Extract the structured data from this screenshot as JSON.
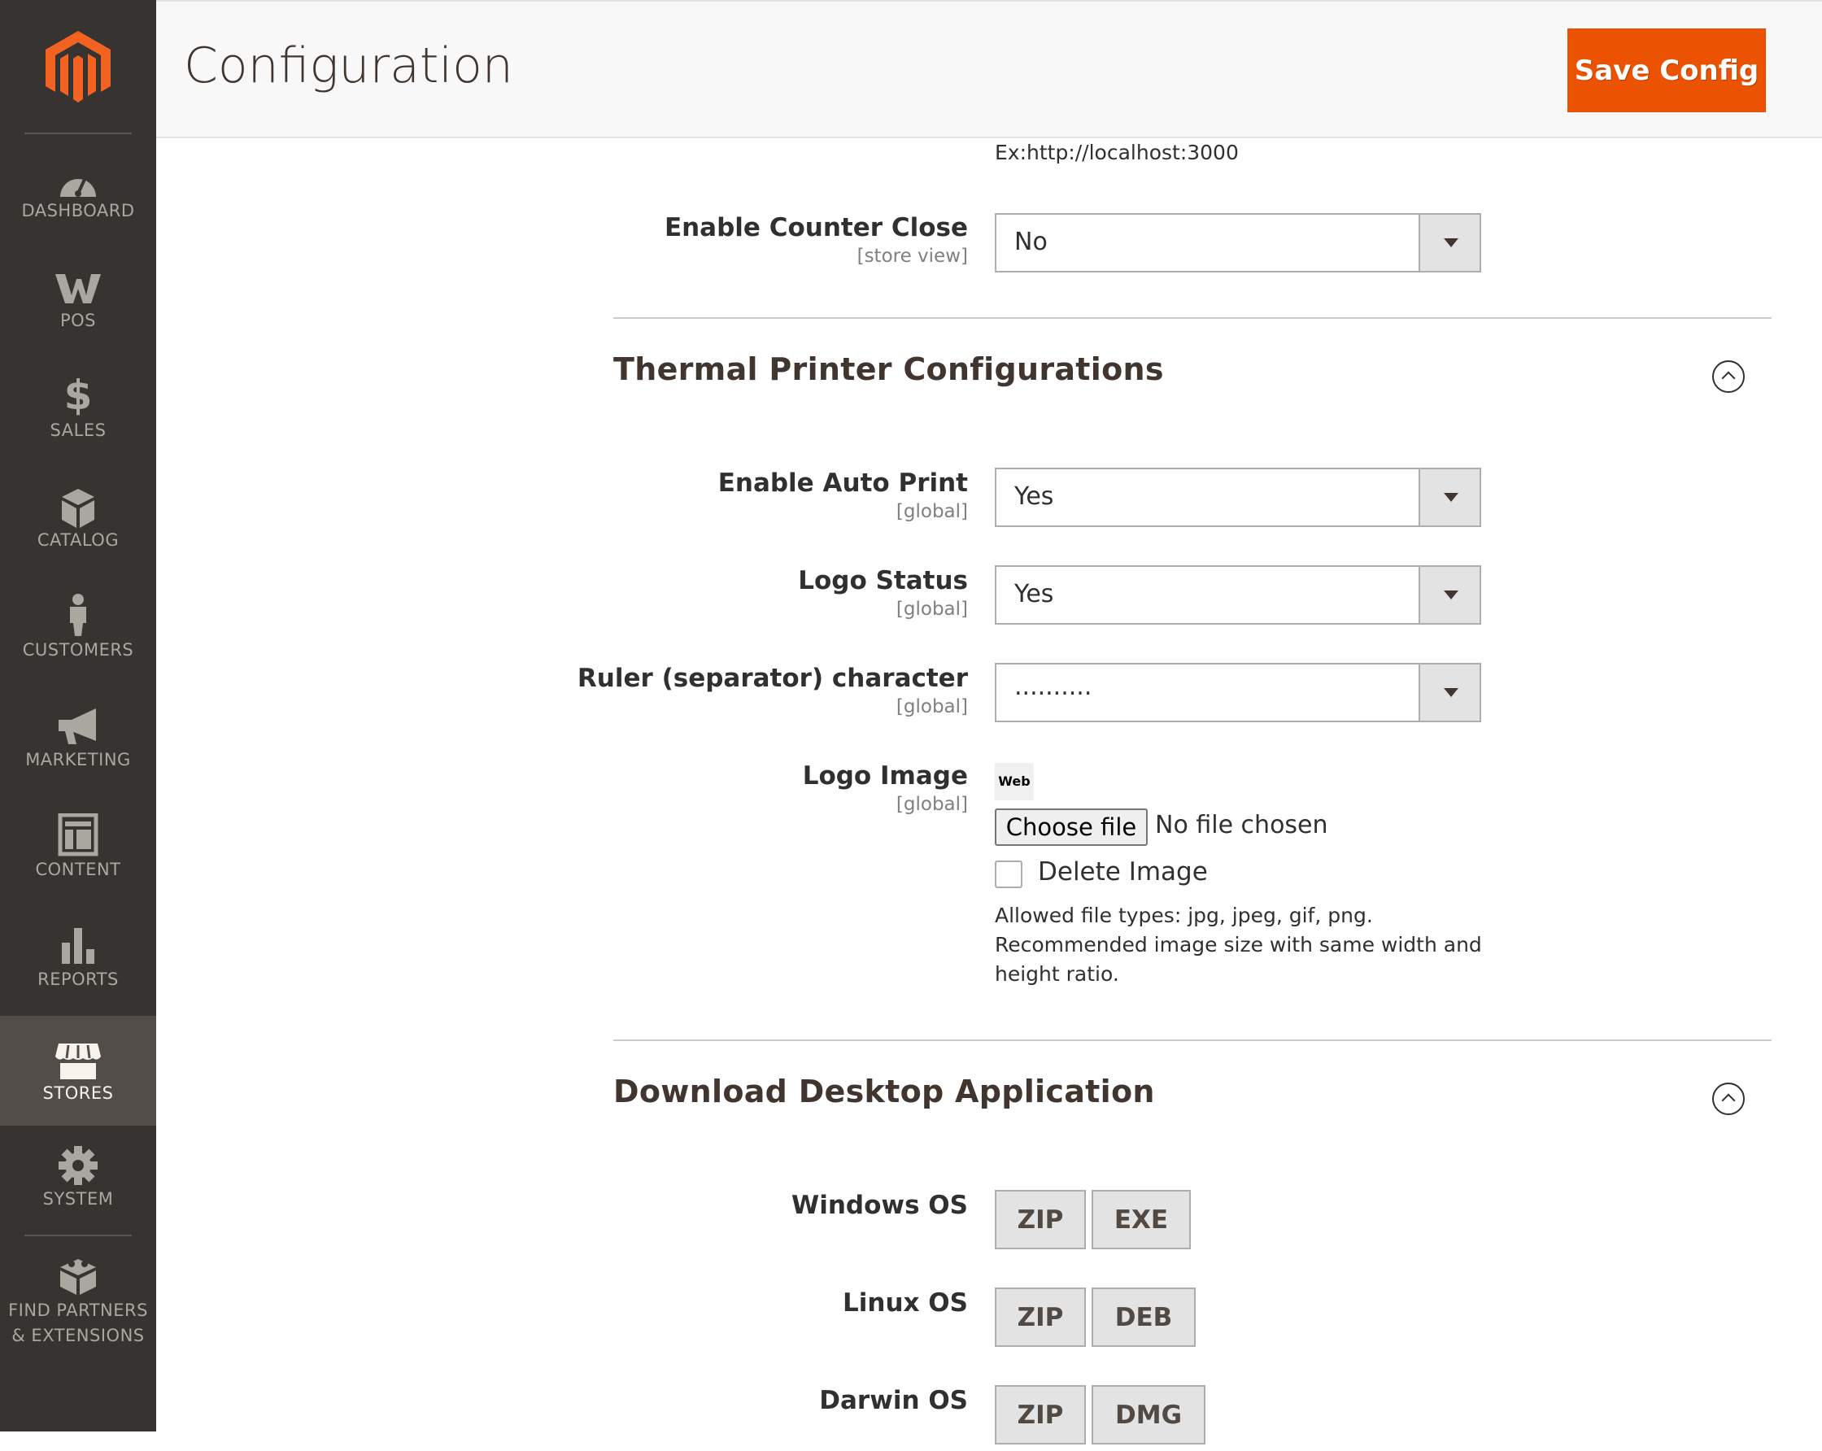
{
  "sidebar": {
    "items": [
      {
        "label": "DASHBOARD",
        "icon": "dashboard-icon"
      },
      {
        "label": "POS",
        "icon": "pos-icon"
      },
      {
        "label": "SALES",
        "icon": "dollar-icon"
      },
      {
        "label": "CATALOG",
        "icon": "cube-icon"
      },
      {
        "label": "CUSTOMERS",
        "icon": "person-icon"
      },
      {
        "label": "MARKETING",
        "icon": "megaphone-icon"
      },
      {
        "label": "CONTENT",
        "icon": "layout-icon"
      },
      {
        "label": "REPORTS",
        "icon": "bar-chart-icon"
      },
      {
        "label": "STORES",
        "icon": "storefront-icon",
        "active": true
      },
      {
        "label": "SYSTEM",
        "icon": "gear-icon"
      },
      {
        "label_line1": "FIND PARTNERS",
        "label_line2": "& EXTENSIONS",
        "icon": "blocks-icon"
      }
    ]
  },
  "header": {
    "title": "Configuration",
    "save_label": "Save Config"
  },
  "socket": {
    "hint": "Ex:http://localhost:3000"
  },
  "counter_close": {
    "label": "Enable Counter Close",
    "scope": "[store view]",
    "value": "No"
  },
  "thermal": {
    "title": "Thermal Printer Configurations",
    "auto_print": {
      "label": "Enable Auto Print",
      "scope": "[global]",
      "value": "Yes"
    },
    "logo_status": {
      "label": "Logo Status",
      "scope": "[global]",
      "value": "Yes"
    },
    "ruler": {
      "label": "Ruler (separator) character",
      "scope": "[global]",
      "value": ".........."
    },
    "logo_image": {
      "label": "Logo Image",
      "scope": "[global]",
      "thumb_text": "Web",
      "choose_file": "Choose file",
      "file_status": "No file chosen",
      "delete_label": "Delete Image",
      "note_line1": "Allowed file types: jpg, jpeg, gif, png.",
      "note_line2": "Recommended image size with same width and",
      "note_line3": "height ratio."
    }
  },
  "download": {
    "title": "Download Desktop Application",
    "windows": {
      "label": "Windows OS",
      "btn1": "ZIP",
      "btn2": "EXE"
    },
    "linux": {
      "label": "Linux OS",
      "btn1": "ZIP",
      "btn2": "DEB"
    },
    "darwin": {
      "label": "Darwin OS",
      "btn1": "ZIP",
      "btn2": "DMG"
    }
  },
  "colors": {
    "sidebar_bg": "#373330",
    "sidebar_active_bg": "#524d49",
    "accent": "#eb5202",
    "logo_orange": "#f26322"
  }
}
